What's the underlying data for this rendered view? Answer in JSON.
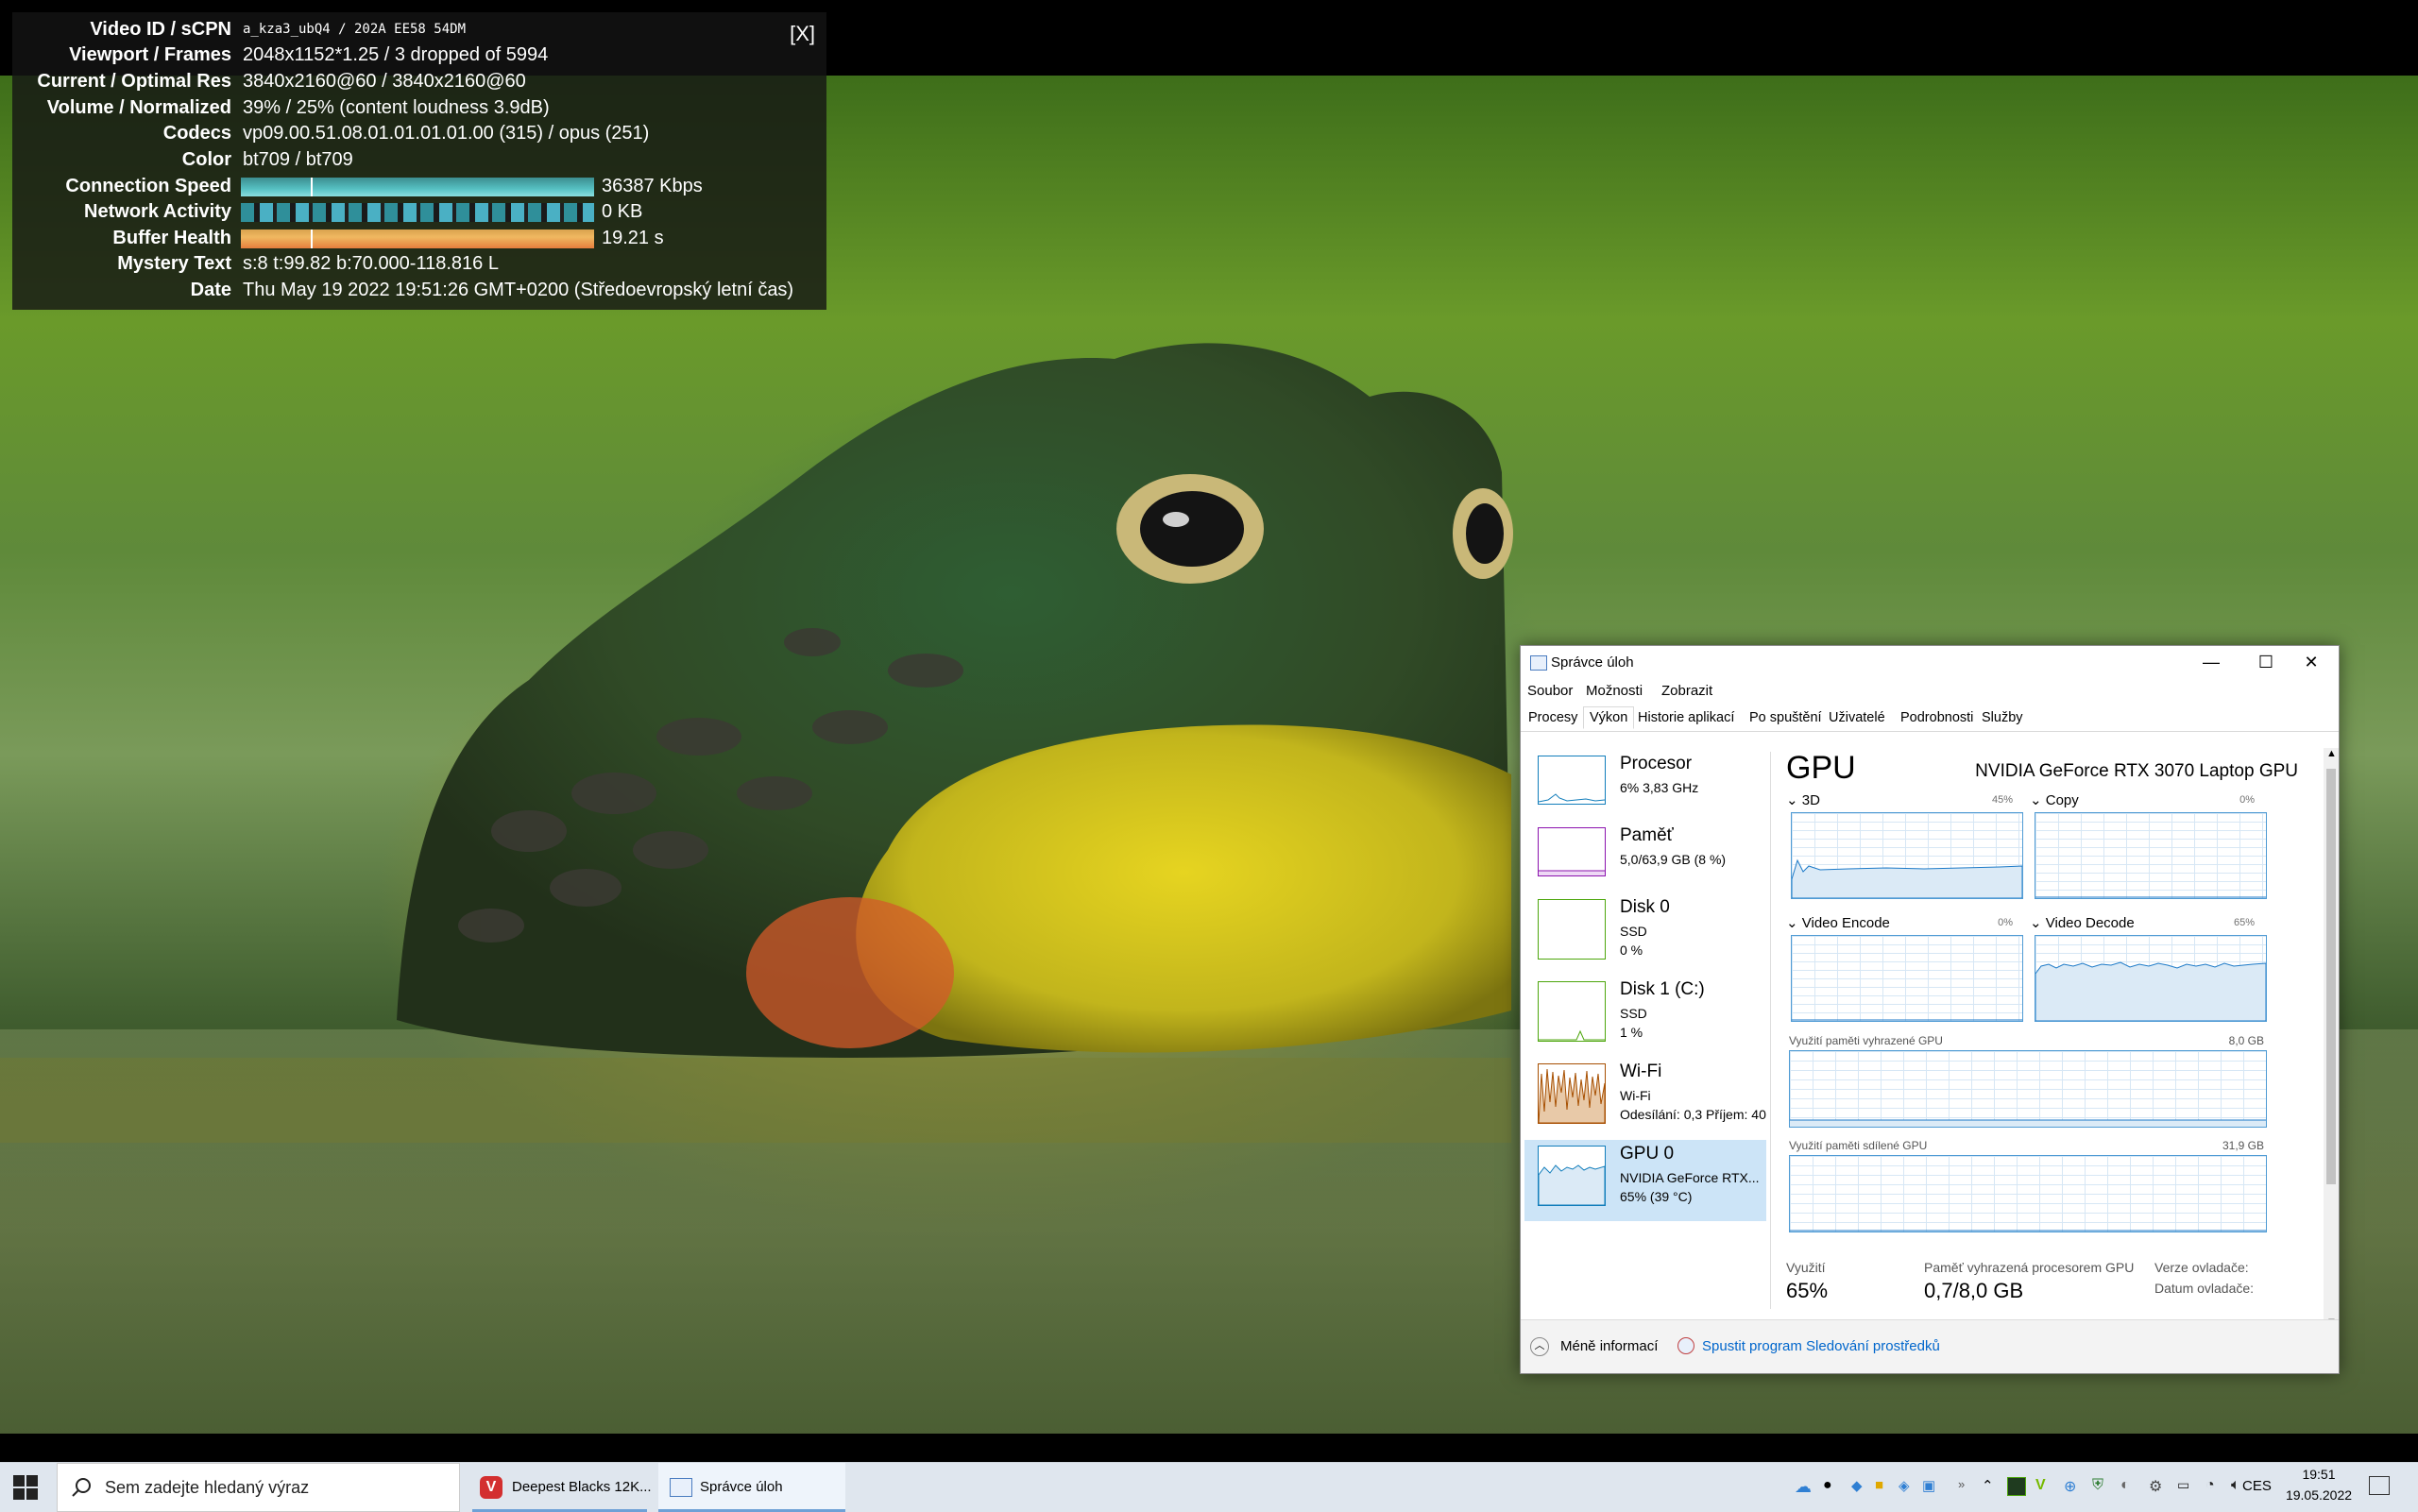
{
  "stats": {
    "close_label": "[X]",
    "rows": [
      {
        "key": "Video ID / sCPN",
        "value": "a_kza3_ubQ4 / 202A EE58 54DM"
      },
      {
        "key": "Viewport / Frames",
        "value": "2048x1152*1.25 / 3 dropped of 5994"
      },
      {
        "key": "Current / Optimal Res",
        "value": "3840x2160@60 / 3840x2160@60"
      },
      {
        "key": "Volume / Normalized",
        "value": "39% / 25% (content loudness 3.9dB)"
      },
      {
        "key": "Codecs",
        "value": "vp09.00.51.08.01.01.01.01.00 (315) / opus (251)"
      },
      {
        "key": "Color",
        "value": "bt709 / bt709"
      },
      {
        "key": "Connection Speed",
        "value": "36387 Kbps"
      },
      {
        "key": "Network Activity",
        "value": "0 KB"
      },
      {
        "key": "Buffer Health",
        "value": "19.21 s"
      },
      {
        "key": "Mystery Text",
        "value": "s:8 t:99.82 b:70.000-118.816 L"
      },
      {
        "key": "Date",
        "value": "Thu May 19 2022 19:51:26 GMT+0200 (Středoevropský letní čas)"
      }
    ]
  },
  "taskmgr": {
    "title": "Správce úloh",
    "window_buttons": {
      "minimize": "—",
      "maximize": "☐",
      "close": "✕"
    },
    "menu": [
      "Soubor",
      "Možnosti",
      "Zobrazit"
    ],
    "tabs": [
      "Procesy",
      "Výkon",
      "Historie aplikací",
      "Po spuštění",
      "Uživatelé",
      "Podrobnosti",
      "Služby"
    ],
    "active_tab": "Výkon",
    "resources": [
      {
        "name": "Procesor",
        "line2": "6% 3,83 GHz",
        "line3": "",
        "color": "#117dbb"
      },
      {
        "name": "Paměť",
        "line2": "5,0/63,9 GB (8 %)",
        "line3": "",
        "color": "#8b12ae"
      },
      {
        "name": "Disk 0",
        "line2": "SSD",
        "line3": "0 %",
        "color": "#4da60c"
      },
      {
        "name": "Disk 1 (C:)",
        "line2": "SSD",
        "line3": "1 %",
        "color": "#4da60c"
      },
      {
        "name": "Wi-Fi",
        "line2": "Wi-Fi",
        "line3": "Odesílání: 0,3  Příjem: 40",
        "color": "#a74f01"
      },
      {
        "name": "GPU 0",
        "line2": "NVIDIA GeForce RTX...",
        "line3": "65%  (39 °C)",
        "color": "#117dbb"
      }
    ],
    "gpu": {
      "title": "GPU",
      "name": "NVIDIA GeForce RTX 3070 Laptop GPU",
      "engines": [
        {
          "label": "3D",
          "pct": "45%",
          "level": 0.45
        },
        {
          "label": "Copy",
          "pct": "0%",
          "level": 0.0
        },
        {
          "label": "Video Encode",
          "pct": "0%",
          "level": 0.0
        },
        {
          "label": "Video Decode",
          "pct": "65%",
          "level": 0.65
        }
      ],
      "dedicated_label": "Využití paměti vyhrazené GPU",
      "dedicated_max": "8,0 GB",
      "shared_label": "Využití paměti sdílené GPU",
      "shared_max": "31,9 GB",
      "stat_labels": {
        "util": "Využití",
        "dedmem": "Paměť vyhrazená procesorem GPU",
        "driver": "Verze ovladače:",
        "driver_date": "Datum ovladače:"
      },
      "stat_values": {
        "util": "65%",
        "dedmem": "0,7/8,0 GB"
      }
    },
    "footer": {
      "less": "Méně informací",
      "monitor": "Spustit program Sledování prostředků"
    }
  },
  "taskbar": {
    "search_placeholder": "Sem zadejte hledaný výraz",
    "apps": [
      {
        "label": "Deepest Blacks 12K..."
      },
      {
        "label": "Správce úloh"
      }
    ],
    "lang": "CES",
    "time": "19:51",
    "date": "19.05.2022"
  },
  "colors": {
    "tm_accent": "#117dbb",
    "gpu_line": "#1c7ac8",
    "taskbar": "#dfe6ee"
  }
}
